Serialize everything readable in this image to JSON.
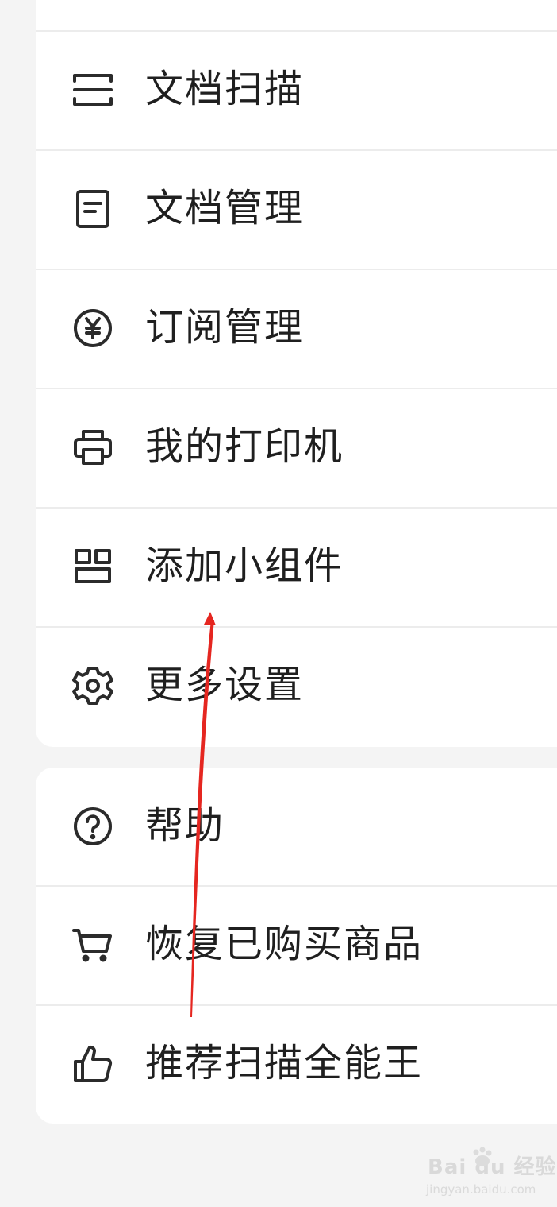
{
  "menu_group_1": [
    {
      "icon": "scan-icon",
      "label": "文档扫描"
    },
    {
      "icon": "document-icon",
      "label": "文档管理"
    },
    {
      "icon": "yen-coin-icon",
      "label": "订阅管理"
    },
    {
      "icon": "printer-icon",
      "label": "我的打印机"
    },
    {
      "icon": "widget-icon",
      "label": "添加小组件"
    },
    {
      "icon": "gear-icon",
      "label": "更多设置"
    }
  ],
  "menu_group_2": [
    {
      "icon": "help-icon",
      "label": "帮助"
    },
    {
      "icon": "cart-icon",
      "label": "恢复已购买商品"
    },
    {
      "icon": "thumbs-up-icon",
      "label": "推荐扫描全能王"
    }
  ],
  "annotation": {
    "color": "#e52620"
  },
  "watermark": {
    "brand": "Bai du 经验",
    "url": "jingyan.baidu.com"
  },
  "colors": {
    "text": "#1f1f1f",
    "icon": "#2b2b2b",
    "background": "#f4f4f4",
    "card": "#ffffff"
  }
}
